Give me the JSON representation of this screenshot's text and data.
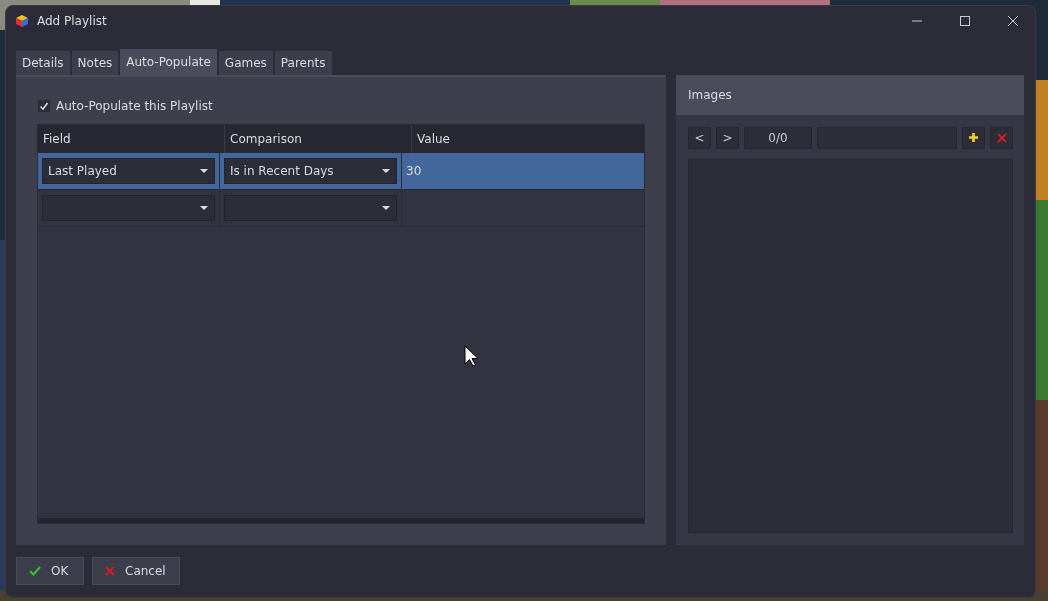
{
  "window": {
    "title": "Add Playlist"
  },
  "tabs": [
    {
      "label": "Details",
      "selected": false
    },
    {
      "label": "Notes",
      "selected": false
    },
    {
      "label": "Auto-Populate",
      "selected": true
    },
    {
      "label": "Games",
      "selected": false
    },
    {
      "label": "Parents",
      "selected": false
    }
  ],
  "auto_populate": {
    "label": "Auto-Populate this Playlist",
    "checked": true
  },
  "table": {
    "columns": [
      "Field",
      "Comparison",
      "Value"
    ],
    "rows": [
      {
        "field": "Last Played",
        "comparison": "Is in Recent Days",
        "value": "30",
        "selected": true
      },
      {
        "field": "",
        "comparison": "",
        "value": "",
        "selected": false
      }
    ]
  },
  "images": {
    "title": "Images",
    "prev": "<",
    "next": ">",
    "counter": "0/0"
  },
  "buttons": [
    {
      "label": "OK",
      "kind": "ok"
    },
    {
      "label": "Cancel",
      "kind": "cancel"
    }
  ]
}
